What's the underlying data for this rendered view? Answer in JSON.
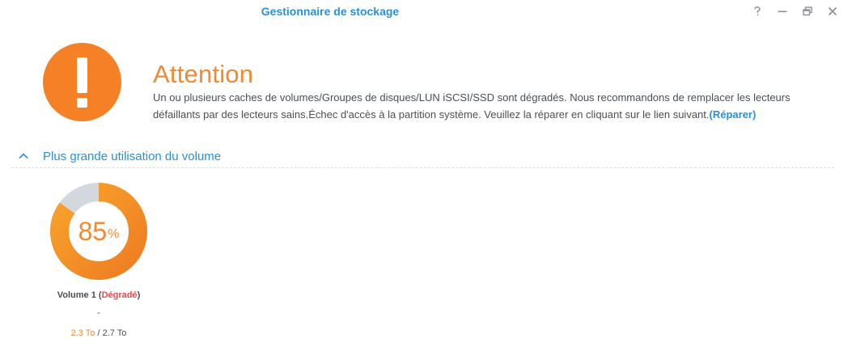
{
  "window": {
    "title": "Gestionnaire de stockage",
    "controls": [
      "help-icon",
      "minimize-icon",
      "restore-icon",
      "close-icon"
    ]
  },
  "alert": {
    "icon": "exclamation-icon",
    "heading": "Attention",
    "message": "Un ou plusieurs caches de volumes/Groupes de disques/LUN iSCSI/SSD sont dégradés. Nous recommandons de remplacer les lecteurs défaillants par des lecteurs sains.Échec d'accès à la partition système. Veuillez la réparer en cliquant sur le lien suivant.",
    "link_label": "(Réparer)",
    "color": "#f58025"
  },
  "section": {
    "title": "Plus grande utilisation du volume",
    "icon": "chevron-up-icon"
  },
  "volume": {
    "usage_value": "85",
    "usage_unit": "%",
    "usage_fraction": 0.85,
    "name": "Volume 1",
    "status_open": " (",
    "status": "Dégradé",
    "status_close": ")",
    "dash": "-",
    "used": "2.3 To",
    "separator": " / ",
    "total": "2.7 To"
  },
  "colors": {
    "accent": "#2a8fd6",
    "warning": "#f08a32",
    "danger": "#e84a4a",
    "ring_light": "#f8a32b",
    "ring_dark": "#ee7d22",
    "ring_free": "#d2d8de"
  }
}
